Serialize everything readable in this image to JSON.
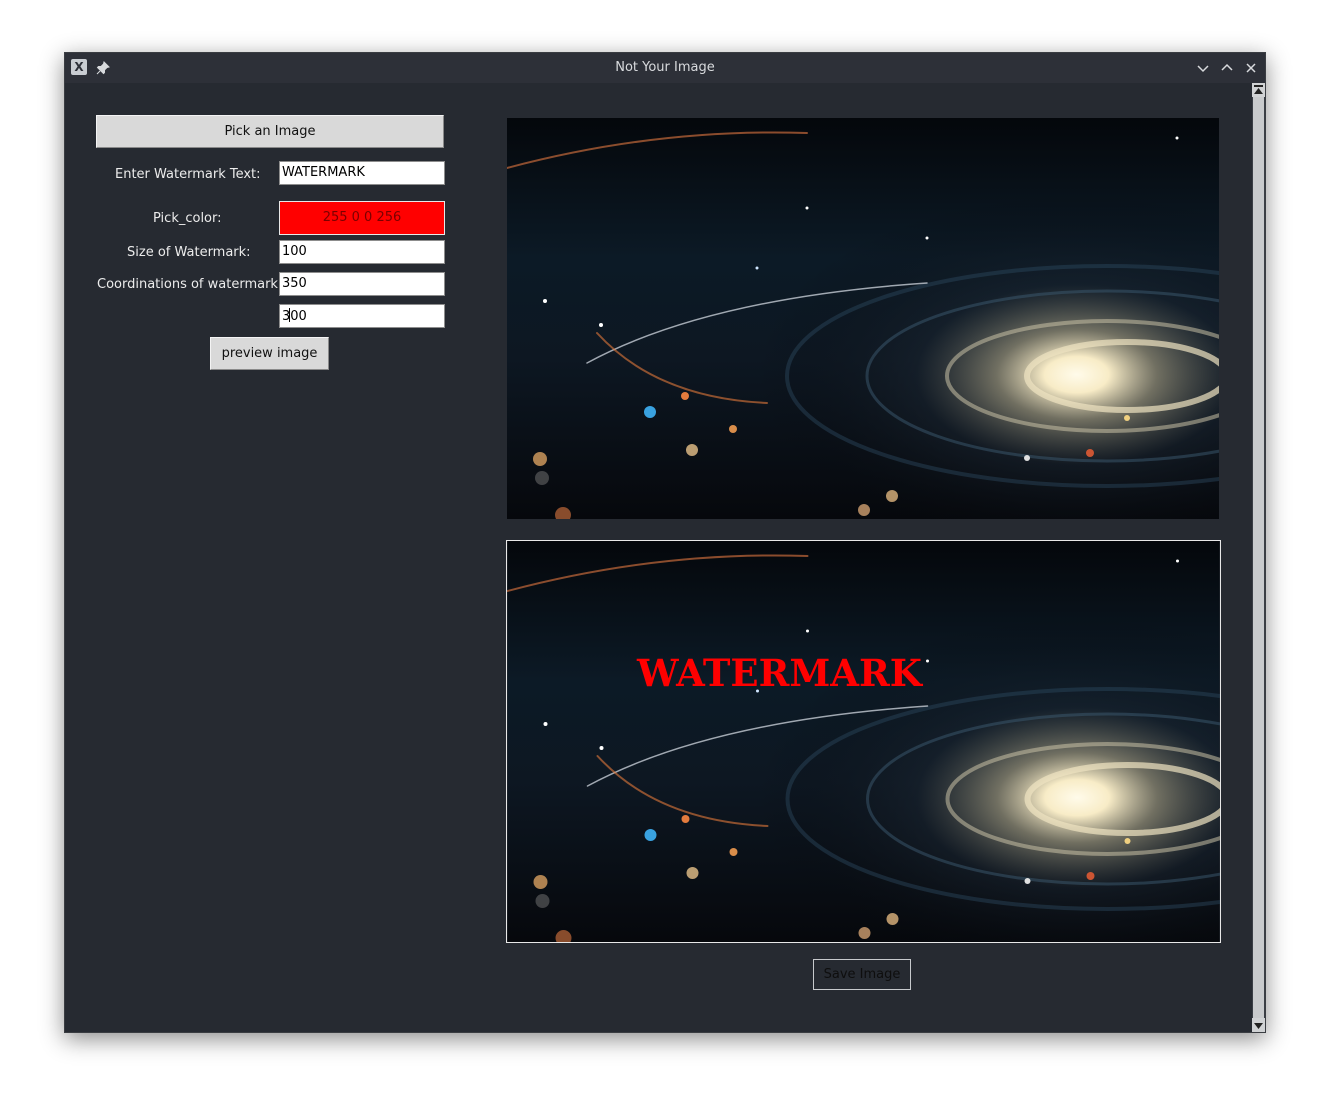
{
  "window": {
    "title": "Not Your Image",
    "app_icon_glyph": "X"
  },
  "controls": {
    "pick_image_label": "Pick an Image",
    "watermark_text_label": "Enter Watermark Text:",
    "watermark_text_value": "WATERMARK",
    "pick_color_label": "Pick_color:",
    "color_value": "255 0 0 256",
    "size_label": "Size of Watermark:",
    "size_value": "100",
    "coords_label": "Coordinations of watermark:",
    "coord_x_value": "350",
    "coord_y_value_a": "3",
    "coord_y_value_b": "00",
    "preview_label": "preview image"
  },
  "preview": {
    "watermark_text": "WATERMARK",
    "watermark_color": "#ff0000"
  },
  "save_label": "Save Image",
  "colors": {
    "window_bg": "#262a31",
    "titlebar_bg": "#2d3038",
    "accent_red": "#ff0000"
  }
}
